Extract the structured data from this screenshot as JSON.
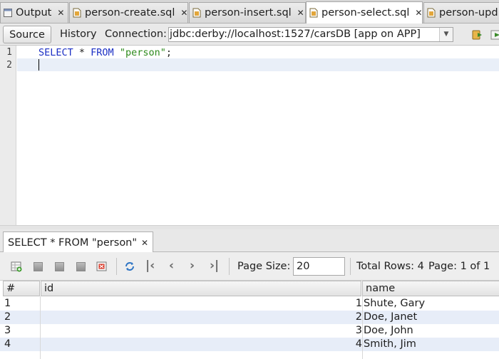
{
  "tabs": [
    {
      "label": "Output",
      "icon": "output-window-icon"
    },
    {
      "label": "person-create.sql",
      "icon": "sql-file-icon"
    },
    {
      "label": "person-insert.sql",
      "icon": "sql-file-icon"
    },
    {
      "label": "person-select.sql",
      "icon": "sql-file-icon"
    },
    {
      "label": "person-upd",
      "icon": "sql-file-icon"
    }
  ],
  "active_tab_index": 3,
  "toolbar": {
    "source_label": "Source",
    "history_label": "History",
    "connection_label": "Connection:",
    "connection_value": "jdbc:derby://localhost:1527/carsDB [app on APP]"
  },
  "editor": {
    "line_numbers": [
      "1",
      "2"
    ],
    "line1": {
      "keyword1": "SELECT",
      "op": " * ",
      "keyword2": "FROM",
      "string": "\"person\"",
      "end": ";"
    }
  },
  "results": {
    "tab_label": "SELECT * FROM \"person\"",
    "page_size_label": "Page Size:",
    "page_size_value": "20",
    "total_rows_text": "Total Rows: 4",
    "page_text": "Page: 1 of 1",
    "columns": [
      "#",
      "id",
      "name"
    ],
    "rows": [
      {
        "num": "1",
        "id": "1",
        "name": "Shute, Gary"
      },
      {
        "num": "2",
        "id": "2",
        "name": "Doe, Janet"
      },
      {
        "num": "3",
        "id": "3",
        "name": "Doe, John"
      },
      {
        "num": "4",
        "id": "4",
        "name": "Smith, Jim"
      }
    ]
  },
  "colors": {
    "keyword": "#1b2fc4",
    "string": "#2c8a1c",
    "selected_row": "#e7edf8"
  }
}
